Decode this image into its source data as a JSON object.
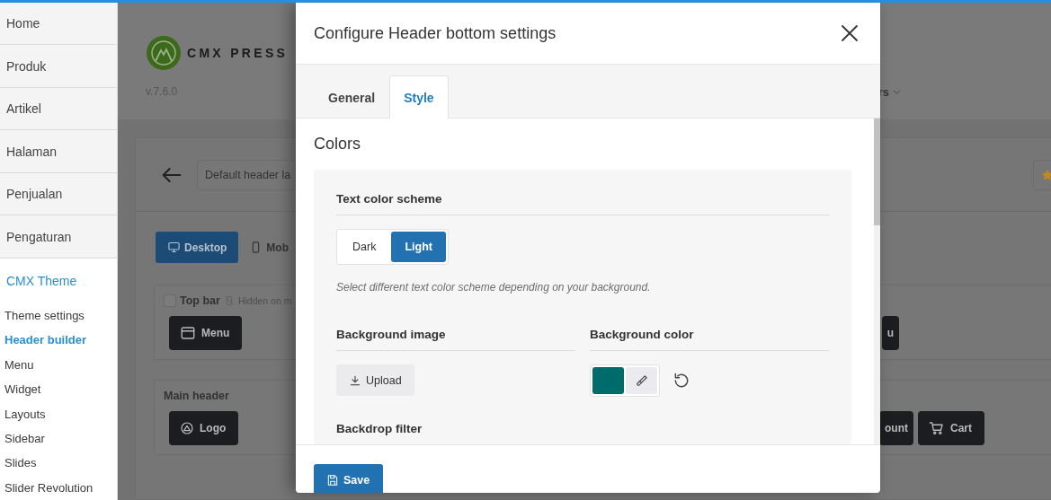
{
  "sidebar": {
    "menu": [
      {
        "label": "Home",
        "selected": false
      },
      {
        "label": "Produk",
        "selected": false
      },
      {
        "label": "Artikel",
        "selected": false
      },
      {
        "label": "Halaman",
        "selected": false
      },
      {
        "label": "Penjualan",
        "selected": false
      },
      {
        "label": "Pengaturan",
        "selected": false
      },
      {
        "label": "CMX Theme",
        "selected": true
      }
    ],
    "submenu": [
      {
        "label": "Theme settings",
        "selected": false
      },
      {
        "label": "Header builder",
        "selected": true
      },
      {
        "label": "Menu",
        "selected": false
      },
      {
        "label": "Widget",
        "selected": false
      },
      {
        "label": "Layouts",
        "selected": false
      },
      {
        "label": "Sidebar",
        "selected": false
      },
      {
        "label": "Slides",
        "selected": false
      },
      {
        "label": "Slider Revolution",
        "selected": false
      }
    ]
  },
  "background_page": {
    "logo": {
      "name": "CMX PRESS"
    },
    "version": "v.7.6.0",
    "nav_item": "rs",
    "layout_field": {
      "value": "Default header la"
    },
    "devices": [
      {
        "label": "Desktop",
        "kind": "desktop",
        "selected": true
      },
      {
        "label": "Mob",
        "kind": "mobile",
        "selected": false
      }
    ],
    "sections": [
      {
        "title": "Top bar",
        "checked": false,
        "note": "Hidden on m",
        "left_items": [
          {
            "label": "Menu",
            "kind": "menu"
          }
        ],
        "right_items": [
          {
            "label": "u",
            "kind": "plain"
          }
        ]
      },
      {
        "title": "Main header",
        "left_items": [
          {
            "label": "Logo",
            "kind": "logo"
          }
        ],
        "right_items": [
          {
            "label": "ount",
            "kind": "plain"
          },
          {
            "label": "Cart",
            "kind": "cart"
          }
        ]
      }
    ]
  },
  "dialog": {
    "title": "Configure Header bottom settings",
    "tabs": [
      {
        "label": "General",
        "selected": false
      },
      {
        "label": "Style",
        "selected": true
      }
    ],
    "section_title": "Colors",
    "text_color_scheme": {
      "label": "Text color scheme",
      "options": [
        {
          "label": "Dark",
          "selected": false
        },
        {
          "label": "Light",
          "selected": true
        }
      ],
      "help": "Select different text color scheme depending on your background."
    },
    "background_image": {
      "label": "Background image",
      "button": "Upload"
    },
    "background_color": {
      "label": "Background color",
      "color": "#006b6b"
    },
    "backdrop_filter": {
      "label": "Backdrop filter"
    },
    "save_button": "Save"
  }
}
